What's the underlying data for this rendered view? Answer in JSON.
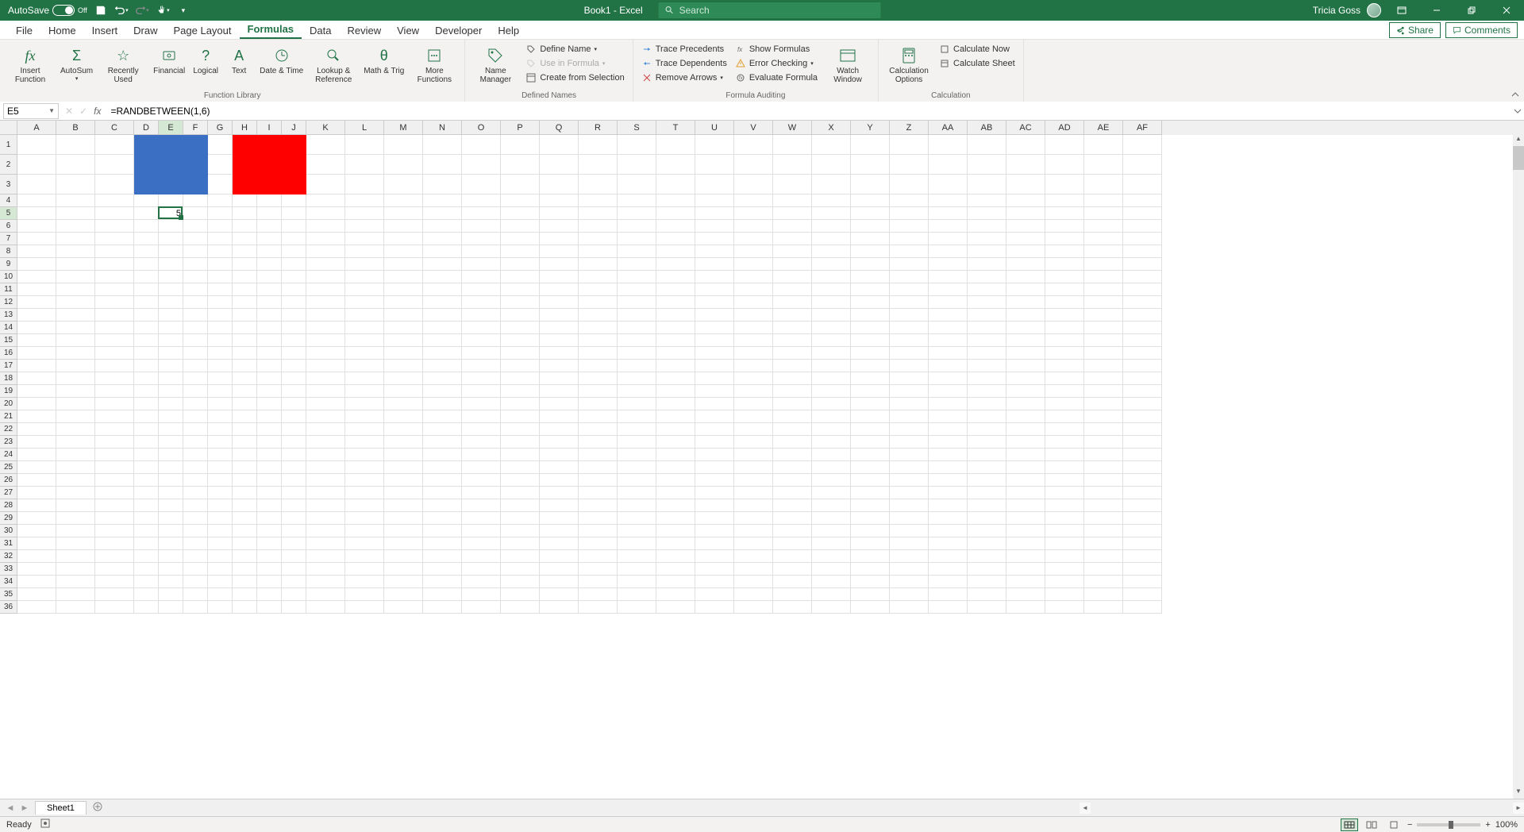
{
  "titleBar": {
    "autosave_label": "AutoSave",
    "autosave_state": "Off",
    "doc_title": "Book1 - Excel",
    "search_placeholder": "Search",
    "user_name": "Tricia Goss"
  },
  "menu": {
    "tabs": [
      "File",
      "Home",
      "Insert",
      "Draw",
      "Page Layout",
      "Formulas",
      "Data",
      "Review",
      "View",
      "Developer",
      "Help"
    ],
    "active_index": 5,
    "share_label": "Share",
    "comments_label": "Comments"
  },
  "ribbon": {
    "groups": {
      "function_library": {
        "label": "Function Library",
        "buttons": [
          "Insert Function",
          "AutoSum",
          "Recently Used",
          "Financial",
          "Logical",
          "Text",
          "Date & Time",
          "Lookup & Reference",
          "Math & Trig",
          "More Functions"
        ]
      },
      "defined_names": {
        "label": "Defined Names",
        "big": "Name Manager",
        "small": [
          "Define Name",
          "Use in Formula",
          "Create from Selection"
        ]
      },
      "formula_auditing": {
        "label": "Formula Auditing",
        "col1": [
          "Trace Precedents",
          "Trace Dependents",
          "Remove Arrows"
        ],
        "col2": [
          "Show Formulas",
          "Error Checking",
          "Evaluate Formula"
        ],
        "big": "Watch Window"
      },
      "calculation": {
        "label": "Calculation",
        "big": "Calculation Options",
        "small": [
          "Calculate Now",
          "Calculate Sheet"
        ]
      }
    }
  },
  "formulaBar": {
    "name_box": "E5",
    "formula": "=RANDBETWEEN(1,6)"
  },
  "grid": {
    "columns": [
      "A",
      "B",
      "C",
      "D",
      "E",
      "F",
      "G",
      "H",
      "I",
      "J",
      "K",
      "L",
      "M",
      "N",
      "O",
      "P",
      "Q",
      "R",
      "S",
      "T",
      "U",
      "V",
      "W",
      "X",
      "Y",
      "Z",
      "AA",
      "AB",
      "AC",
      "AD",
      "AE",
      "AF"
    ],
    "col_widths": {
      "default": 49,
      "narrow": 32,
      "A": 49,
      "B": 49,
      "C": 49,
      "D": 32,
      "E": 30,
      "F": 32,
      "G": 32,
      "H": 30,
      "I": 30,
      "J": 32
    },
    "row_count": 36,
    "tall_rows": [
      1,
      2,
      3
    ],
    "blue_range": "D1:F3",
    "red_range": "H1:J3",
    "selected_cell": "E5",
    "cell_values": {
      "E5": "5"
    }
  },
  "sheetBar": {
    "tabs": [
      "Sheet1"
    ],
    "active": 0
  },
  "statusBar": {
    "ready": "Ready",
    "zoom": "100%"
  }
}
